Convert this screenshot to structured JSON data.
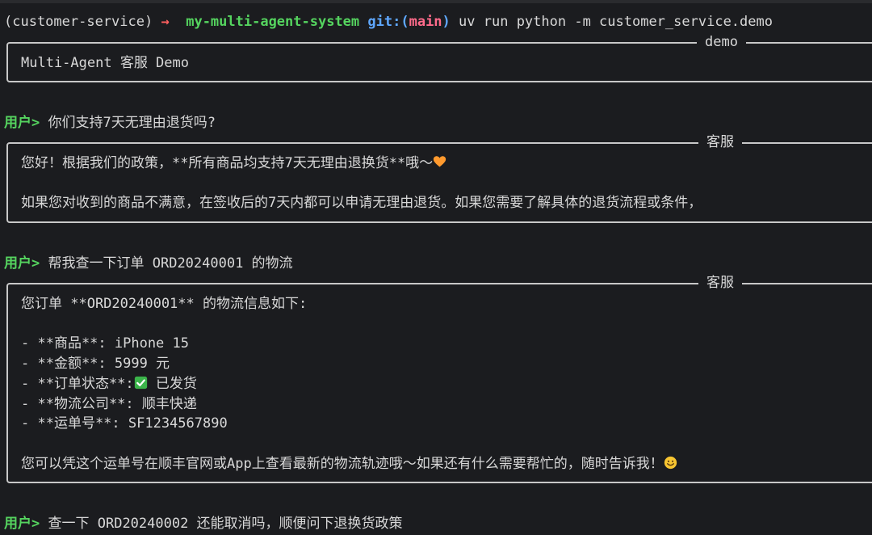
{
  "prompt": {
    "env": "(customer-service)",
    "arrow": "→",
    "repo": "my-multi-agent-system",
    "git_label": "git:(",
    "branch": "main",
    "git_close": ")",
    "command": "uv run python -m customer_service.demo"
  },
  "demo_panel": {
    "title": "demo",
    "body": "Multi-Agent 客服 Demo"
  },
  "user_label": "用户>",
  "turns": [
    {
      "user_text": "你们支持7天无理由退货吗?",
      "panel_title": "客服",
      "lines": [
        "您好！根据我们的政策，**所有商品均支持7天无理由退换货**哦～",
        "",
        "如果您对收到的商品不满意，在签收后的7天内都可以申请无理由退货。如果您需要了解具体的退货流程或条件，"
      ],
      "line1_emoji": "orange-heart"
    },
    {
      "user_text": "帮我查一下订单 ORD20240001 的物流",
      "panel_title": "客服",
      "lines": [
        "您订单 **ORD20240001** 的物流信息如下:",
        "",
        "- **商品**: iPhone 15",
        "- **金额**: 5999 元",
        "- **订单状态**:",
        "- **物流公司**: 顺丰快递",
        "- **运单号**: SF1234567890",
        "",
        "您可以凭这个运单号在顺丰官网或App上查看最新的物流轨迹哦～如果还有什么需要帮忙的，随时告诉我！"
      ],
      "status_value": "已发货",
      "status_emoji": "check-mark",
      "last_emoji": "smile"
    },
    {
      "user_text": "查一下 ORD20240002 还能取消吗，顺便问下退换货政策"
    }
  ],
  "colors": {
    "background": "#1b1c1f",
    "green": "#55d45f",
    "blue": "#5fa8ff",
    "red": "#ff5f5f",
    "pink": "#ff6b8b",
    "border": "#c8c8c8",
    "text": "#d8d8d8"
  }
}
